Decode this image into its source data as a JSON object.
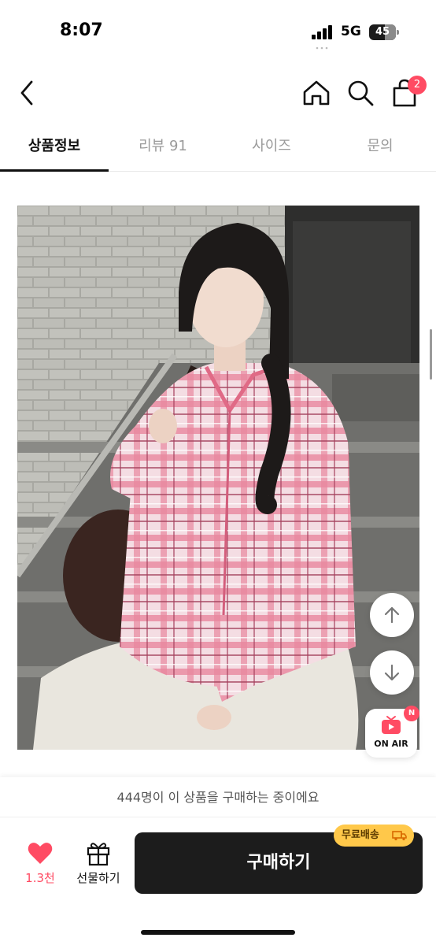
{
  "status_bar": {
    "time": "8:07",
    "network": "5G",
    "battery": "45"
  },
  "header": {
    "back_icon": "chevron-left-icon",
    "home_icon": "home-icon",
    "search_icon": "search-icon",
    "cart_icon": "shopping-bag-icon",
    "cart_count": "2"
  },
  "tabs": [
    {
      "label": "상품정보",
      "active": true
    },
    {
      "label": "리뷰 91",
      "active": false
    },
    {
      "label": "사이즈",
      "active": false
    },
    {
      "label": "문의",
      "active": false
    }
  ],
  "floating": {
    "up_icon": "arrow-up-icon",
    "down_icon": "arrow-down-icon",
    "onair_label": "ON AIR",
    "onair_badge": "N"
  },
  "viewers_text": "444명이 이 상품을 구매하는 중이에요",
  "actions": {
    "like_count": "1.3천",
    "gift_label": "선물하기",
    "buy_label": "구매하기",
    "shipping_badge": "무료배송"
  },
  "colors": {
    "accent": "#ff4b63",
    "buy_button": "#1c1c1c",
    "shipping_badge": "#ffc84a"
  }
}
